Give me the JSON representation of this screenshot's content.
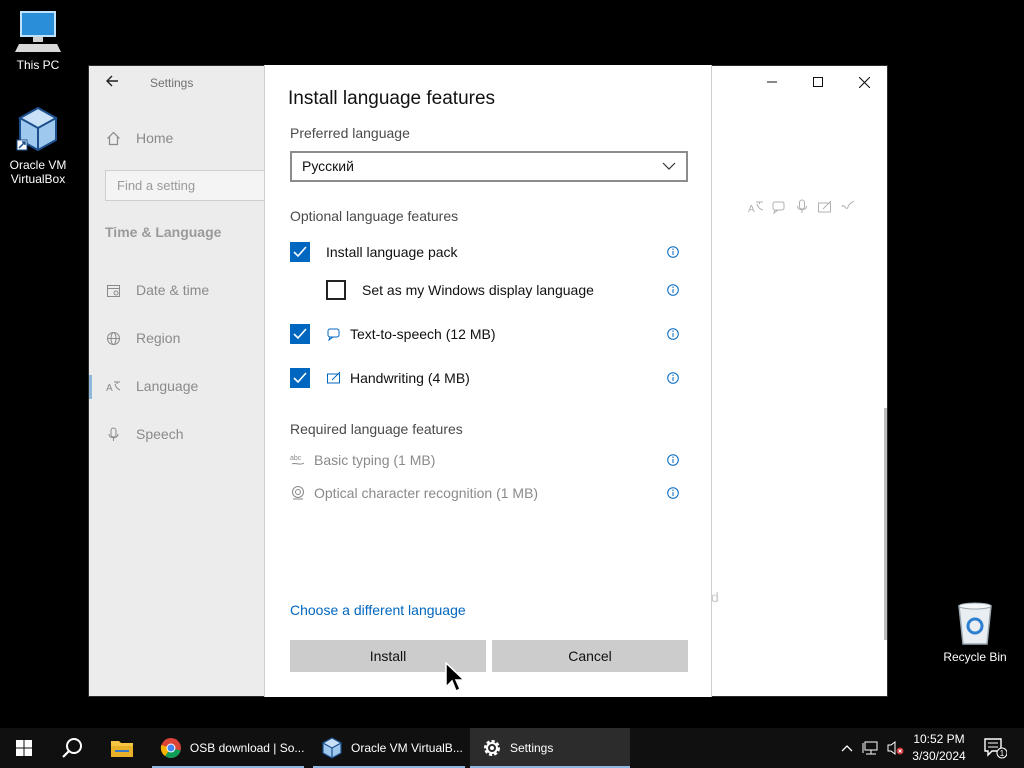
{
  "desktop": {
    "icons": [
      {
        "label_line1": "This PC",
        "label_line2": ""
      },
      {
        "label_line1": "Oracle VM",
        "label_line2": "VirtualBox"
      },
      {
        "label_line1": "Recycle Bin",
        "label_line2": ""
      }
    ]
  },
  "settings": {
    "app_title": "Settings",
    "home": "Home",
    "search_placeholder": "Find a setting",
    "section": "Time & Language",
    "nav": [
      {
        "label": "Date & time",
        "icon": "calendar-icon"
      },
      {
        "label": "Region",
        "icon": "globe-icon"
      },
      {
        "label": "Language",
        "icon": "language-icon",
        "selected": true
      },
      {
        "label": "Speech",
        "icon": "microphone-icon"
      }
    ],
    "background_partial_text": "d"
  },
  "dialog": {
    "title": "Install language features",
    "preferred_label": "Preferred language",
    "preferred_value": "Русский",
    "optional_label": "Optional language features",
    "options": [
      {
        "label": "Install language pack",
        "checked": true
      },
      {
        "label": "Set as my Windows display language",
        "checked": false
      },
      {
        "label": "Text-to-speech (12 MB)",
        "checked": true,
        "icon": "speech-bubble-icon"
      },
      {
        "label": "Handwriting (4 MB)",
        "checked": true,
        "icon": "pen-pad-icon"
      }
    ],
    "required_label": "Required language features",
    "required": [
      {
        "label": "Basic typing (1 MB)",
        "icon": "abc-icon"
      },
      {
        "label": "Optical character recognition (1 MB)",
        "icon": "camera-icon"
      }
    ],
    "choose_link": "Choose a different language",
    "install_button": "Install",
    "cancel_button": "Cancel"
  },
  "taskbar": {
    "apps": [
      {
        "label": "OSB download | So...",
        "icon": "chrome-icon"
      },
      {
        "label": "Oracle VM VirtualB...",
        "icon": "virtualbox-icon"
      },
      {
        "label": "Settings",
        "icon": "gear-icon",
        "active": true
      }
    ],
    "time": "10:52 PM",
    "date": "3/30/2024",
    "notification_count": "1"
  },
  "colors": {
    "accent": "#0067c0",
    "taskbar": "#101010",
    "nav_bg": "#ececec"
  }
}
